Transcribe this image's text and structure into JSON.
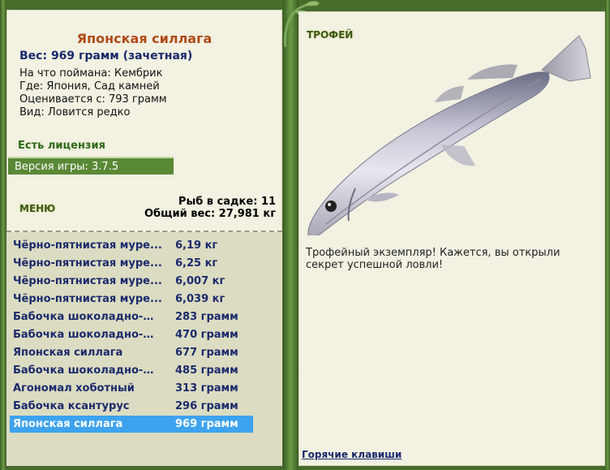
{
  "fish": {
    "name": "Японская силлага",
    "weight_line": "Вес: 969 грамм (зачетная)",
    "bait": "На что поймана: Кембрик",
    "location": "Где: Япония, Сад камней",
    "valued_from": "Оценивается с: 793 грамм",
    "rarity": "Вид: Ловится редко"
  },
  "license": "Есть лицензия",
  "version": "Версия игры: 3.7.5",
  "menu_label": "МЕНЮ",
  "stats": {
    "fish_count": "Рыб в садке: 11",
    "total_weight": "Общий вес: 27,981 кг"
  },
  "catch_list": [
    {
      "name": "Чёрно-пятнистая муре...",
      "weight": "6,19 кг"
    },
    {
      "name": "Чёрно-пятнистая муре...",
      "weight": "6,25 кг"
    },
    {
      "name": "Чёрно-пятнистая муре...",
      "weight": "6,007 кг"
    },
    {
      "name": "Чёрно-пятнистая муре...",
      "weight": "6,039 кг"
    },
    {
      "name": "Бабочка шоколадно-жё...",
      "weight": "283 грамм"
    },
    {
      "name": "Бабочка шоколадно-жё...",
      "weight": "470 грамм"
    },
    {
      "name": "Японская силлага",
      "weight": "677 грамм"
    },
    {
      "name": "Бабочка шоколадно-жё...",
      "weight": "485 грамм"
    },
    {
      "name": "Агономал хоботный",
      "weight": "313 грамм"
    },
    {
      "name": "Бабочка ксантурус",
      "weight": "296 грамм"
    },
    {
      "name": "Японская силлага",
      "weight": "969 грамм",
      "selected": true
    }
  ],
  "trophy": {
    "header": "ТРОФЕЙ",
    "text": "Трофейный экземпляр! Кажется, вы открыли секрет успешной ловли!"
  },
  "hotkeys_link": "Горячие клавиши",
  "colors": {
    "frame_green": "#466c2c",
    "panel_bg": "#f2f1e2",
    "list_bg": "#dcdcc2",
    "selection": "#3da3ef",
    "title": "#b04a16",
    "link_text": "#1a2a6c"
  }
}
